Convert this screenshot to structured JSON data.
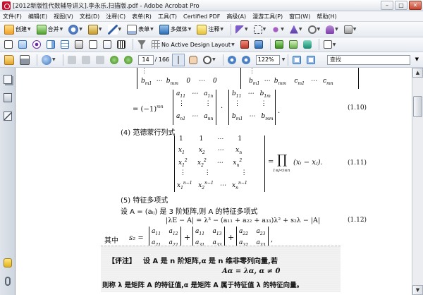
{
  "window": {
    "title": "[2012新版性代数辅导讲义].李永乐.扫描版.pdf - Adobe Acrobat Pro",
    "minimize_label": "–",
    "maximize_label": "□",
    "close_label": "✕"
  },
  "menu": {
    "items": [
      "文件(F)",
      "编辑(E)",
      "视图(V)",
      "文档(D)",
      "注释(C)",
      "表单(R)",
      "工具(T)",
      "Certified PDF",
      "高级(A)",
      "漫游工具(P)",
      "窗口(W)",
      "帮助(H)"
    ]
  },
  "toolbar1": {
    "create_label": "创建",
    "combine_label": "合并",
    "forms_label": "表单",
    "multimedia_label": "多媒体",
    "comment_label": "注释"
  },
  "toolbar2": {
    "design_layout_label": "No Active Design Layout"
  },
  "toolbar3": {
    "current_page": "14",
    "total_pages": "/ 166",
    "zoom_value": "122%",
    "search_placeholder": "查找"
  },
  "document": {
    "sec4_title": "(4) 范德蒙行列式",
    "sec5_title": "(5) 特征多项式",
    "eq110": "(1.10)",
    "eq111": "(1.11)",
    "eq112": "(1.12)",
    "minus_one_pow": "= (−1)",
    "mn_exp": "mn",
    "char_poly_intro": "设 A = (aᵢⱼ) 是 3 阶矩阵,则 A 的特征多项式",
    "char_poly_eq": "|λE − A| = λ³ − (a₁₁ + a₂₂ + a₃₃)λ² + s₂λ − |A|",
    "where_label": "其中",
    "s2_label": "s₂ =",
    "prod_symbol": "∏",
    "prod_sub": "1≤j<i≤n",
    "prod_term": "(xᵢ − xⱼ).",
    "remark_label": "【评注】",
    "remark_line1": "设 A 是 n 阶矩阵,α 是 n 维非零列向量,若",
    "remark_line2": "Aα = λα, α ≠ 0",
    "remark_line3": "则称 λ 是矩阵 A 的特征值,α 是矩阵 A 属于特征值 λ 的特征向量。"
  }
}
